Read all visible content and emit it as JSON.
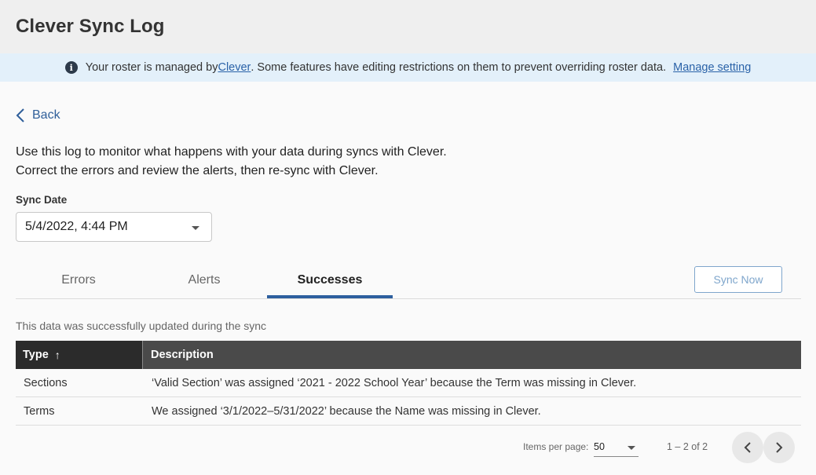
{
  "header": {
    "title": "Clever Sync Log"
  },
  "banner": {
    "text_before": "Your roster is managed by ",
    "clever_link": "Clever",
    "text_after": ". Some features have editing restrictions on them to prevent overriding roster data.",
    "manage_link": "Manage setting",
    "icon": "info-icon"
  },
  "back": {
    "label": "Back",
    "icon": "chevron-left-icon"
  },
  "intro": {
    "line1": "Use this log to monitor what happens with your data during syncs with Clever.",
    "line2": "Correct the errors and review the alerts, then re-sync with Clever."
  },
  "sync_date": {
    "label": "Sync Date",
    "selected": "5/4/2022, 4:44 PM"
  },
  "tabs": [
    {
      "label": "Errors",
      "active": false
    },
    {
      "label": "Alerts",
      "active": false
    },
    {
      "label": "Successes",
      "active": true
    }
  ],
  "sync_now_label": "Sync Now",
  "table": {
    "caption": "This data was successfully updated during the sync",
    "headers": {
      "type": "Type",
      "description": "Description"
    },
    "sort_icon": "arrow-up-icon",
    "rows": [
      {
        "type": "Sections",
        "description": "‘Valid Section’ was assigned ‘2021 - 2022 School Year’ because the Term was missing in Clever."
      },
      {
        "type": "Terms",
        "description": "We assigned ‘3/1/2022–5/31/2022’ because the Name was missing in Clever."
      }
    ]
  },
  "pagination": {
    "items_per_page_label": "Items per page:",
    "items_per_page": "50",
    "range": "1 – 2 of 2"
  },
  "colors": {
    "accent": "#2d5f9e",
    "banner_bg": "#e3f0fa",
    "header_bg": "#efefef",
    "table_header_dark": "#2b2b2b",
    "table_header": "#4a4a4a"
  }
}
